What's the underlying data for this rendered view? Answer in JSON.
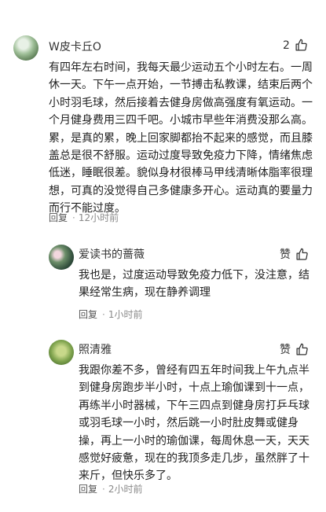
{
  "main_comment": {
    "username": "W皮卡丘O",
    "likes": "2",
    "text": "有四年左右时间，我每天最少运动五个小时左右。一周休一天。下午一点开始，一节搏击私教课，结束后两个小时羽毛球，然后接着去健身房做高强度有氧运动。一个月健身费用三四千吧。小城市早些年消费没那么高。累，是真的累，晚上回家脚都抬不起来的感觉，而且膝盖总是很不舒服。运动过度导致免疫力下降，情绪焦虑低迷，睡眠很差。貌似身材很棒马甲线清晰体脂率很理想，可真的没觉得自己多健康多开心。运动真的要量力而行不能过度。",
    "reply_label": "回复",
    "time": "12小时前"
  },
  "replies": [
    {
      "username": "爱读书的蔷薇",
      "like_label": "赞",
      "text": "我也是，过度运动导致免疫力低下，没注意，结果经常生病，现在静养调理",
      "reply_label": "回复",
      "time": "1小时前"
    },
    {
      "username": "照清雅",
      "like_label": "赞",
      "text": "我跟你差不多，曾经有四五年时间我上午九点半到健身房跑步半小时，十点上瑜伽课到十一点，再练半小时器械，下午三四点到健身房打乒乓球或羽毛球一小时，然后跳一小时肚皮舞或健身操，再上一小时的瑜伽课，每周休息一天，天天感觉好疲惫，现在的我顶多走几步，虽然胖了十来斤，但快乐多了。",
      "reply_label": "回复",
      "time": "2小时前"
    }
  ],
  "icons": {
    "like": "thumbs-up-icon"
  }
}
